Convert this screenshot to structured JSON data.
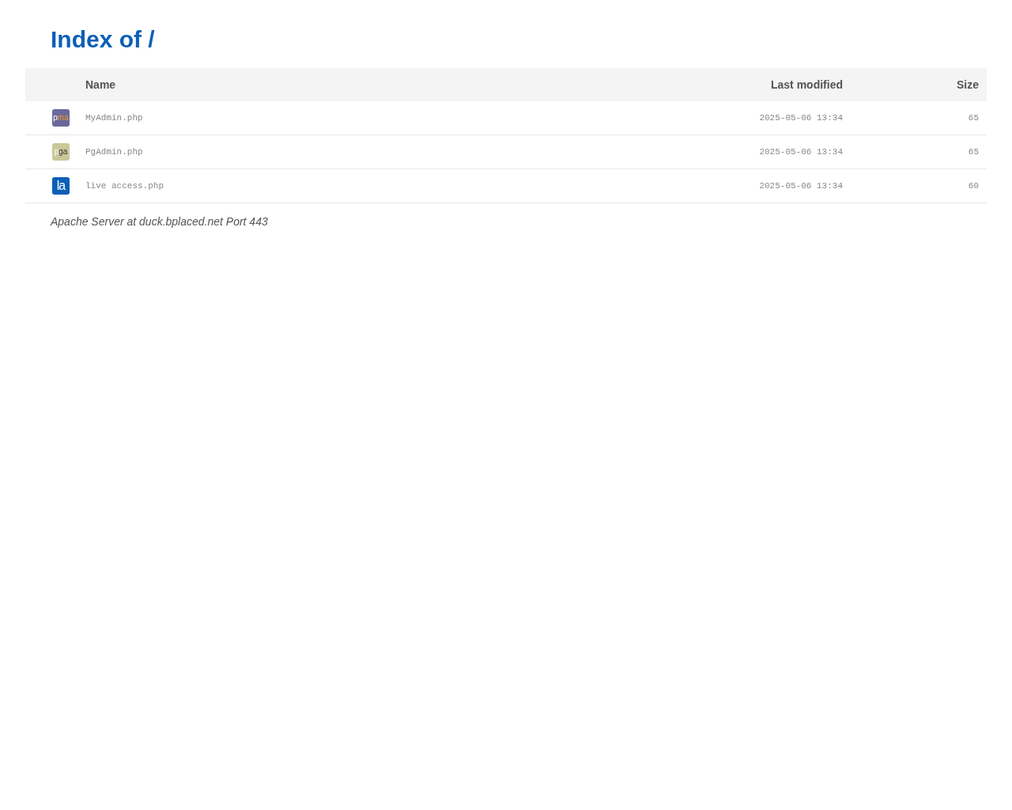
{
  "title": "Index of /",
  "table": {
    "columns": [
      "Name",
      "Last modified",
      "Size"
    ],
    "rows": [
      {
        "badge": {
          "first": "p",
          "rest": "ma",
          "color": "#6a699b"
        },
        "name": "MyAdmin.php",
        "modified": "2025-05-06 13:34",
        "size": "65"
      },
      {
        "badge": {
          "first": "p",
          "rest": "ga",
          "color": "#c9c99a"
        },
        "name": "PgAdmin.php",
        "modified": "2025-05-06 13:34",
        "size": "65"
      },
      {
        "badge": {
          "first": "la",
          "color": "#0c5fb7"
        },
        "name": "live access.php",
        "modified": "2025-05-06 13:34",
        "size": "60"
      }
    ]
  },
  "footer": "Apache Server at duck.bplaced.net Port 443"
}
